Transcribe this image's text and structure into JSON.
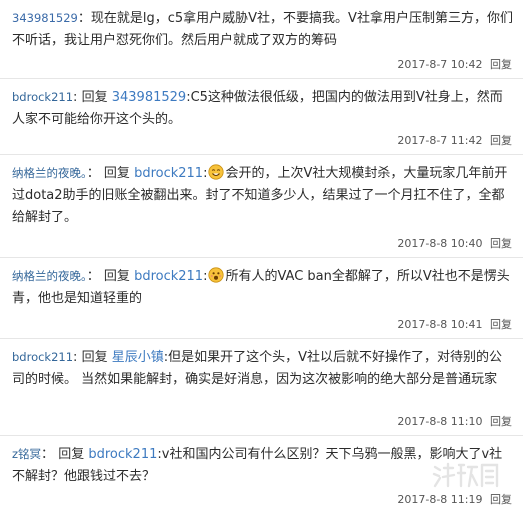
{
  "comments": [
    {
      "user": "343981529",
      "reply_word": "",
      "reply_to": "",
      "text": "现在就是lg，c5拿用户威胁V社，不要搞我。V社拿用户压制第三方，你们不听话，我让用户怼死你们。然后用户就成了双方的筹码",
      "emoji": "",
      "text2": "",
      "time": "2017-8-7 10:42",
      "reply_label": "回复"
    },
    {
      "user": "bdrock211",
      "reply_word": "回复",
      "reply_to": "343981529",
      "text": ":C5这种做法很低级，把国内的做法用到V社身上，然而人家不可能给你开这个头的。",
      "emoji": "",
      "text2": "",
      "time": "2017-8-7 11:42",
      "reply_label": "回复"
    },
    {
      "user": "纳格兰的夜晚。",
      "reply_word": "回复",
      "reply_to": "bdrock211",
      "text": ":",
      "emoji": "smile-emoji",
      "text2": "会开的，上次V社大规模封杀，大量玩家几年前开过dota2助手的旧账全被翻出来。封了不知道多少人，结果过了一个月扛不住了，全都给解封了。",
      "time": "2017-8-8 10:40",
      "reply_label": "回复"
    },
    {
      "user": "纳格兰的夜晚。",
      "reply_word": "回复",
      "reply_to": "bdrock211",
      "text": ":",
      "emoji": "surprised-emoji",
      "text2": "所有人的VAC ban全都解了，所以V社也不是愣头青，他也是知道轻重的",
      "time": "2017-8-8 10:41",
      "reply_label": "回复"
    },
    {
      "user": "bdrock211",
      "reply_word": "回复",
      "reply_to": "星辰小镇",
      "text": ":但是如果开了这个头，V社以后就不好操作了，对待别的公司的时候。 当然如果能解封，确实是好消息，因为这次被影响的绝大部分是普通玩家",
      "emoji": "",
      "text2": "",
      "time": "2017-8-8 11:10",
      "reply_label": "回复"
    },
    {
      "user": "z铭冥",
      "reply_word": "回复",
      "reply_to": "bdrock211",
      "text": ":v社和国内公司有什么区别？天下乌鸦一般黑，影响大了v社不解封？他跟钱过不去？",
      "emoji": "",
      "text2": "",
      "time": "2017-8-8 11:19",
      "reply_label": "回复"
    }
  ],
  "watermark_text": "游侠网",
  "colors": {
    "link": "#3d7ac0",
    "divider": "#e6e6e6",
    "emoji_face": "#f7c23a"
  }
}
